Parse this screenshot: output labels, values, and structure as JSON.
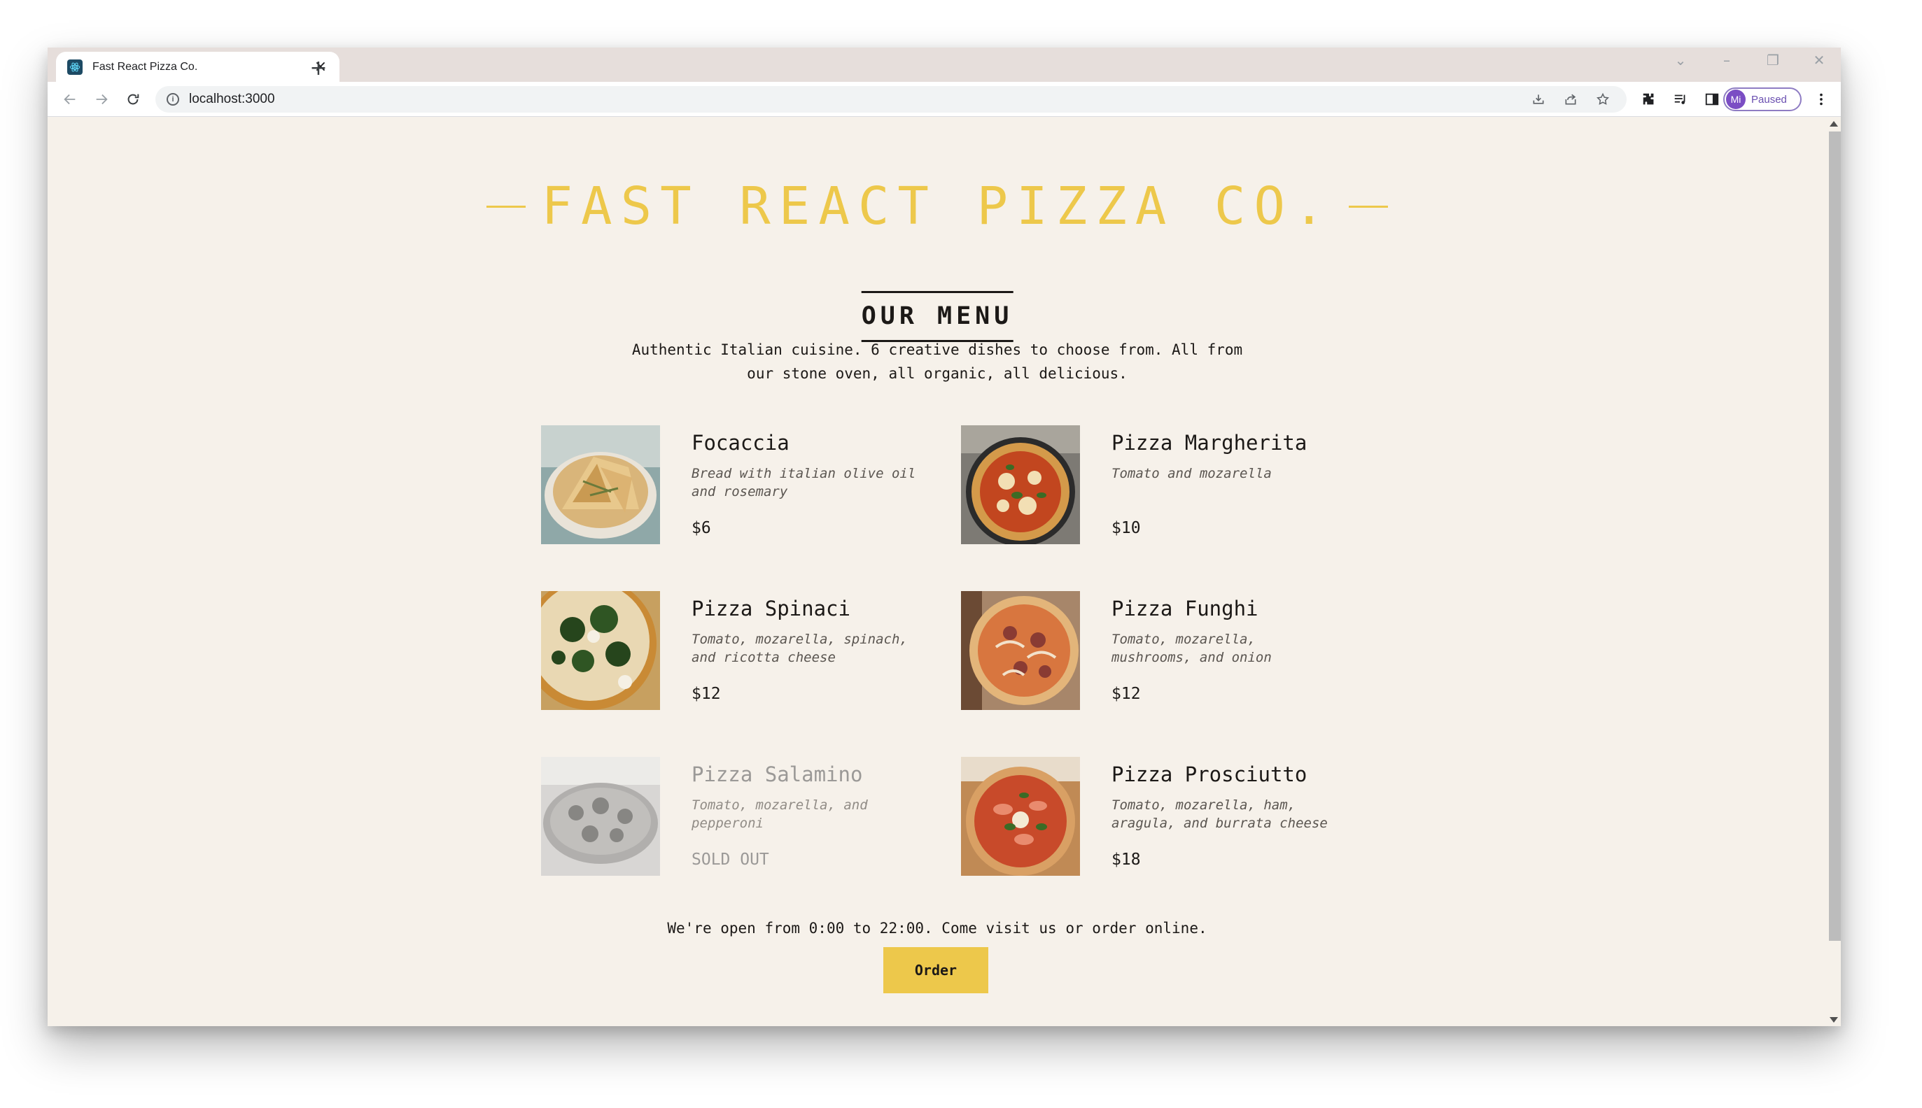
{
  "browser": {
    "tab_title": "Fast React Pizza Co.",
    "url": "localhost:3000",
    "profile_initials": "Mi",
    "profile_status": "Paused"
  },
  "page": {
    "brand": "FAST REACT PIZZA CO.",
    "menu_title": "OUR MENU",
    "intro": "Authentic Italian cuisine. 6 creative dishes to choose from. All from our stone oven, all organic, all delicious.",
    "pizzas": [
      {
        "name": "Focaccia",
        "ingredients": "Bread with italian olive oil and rosemary",
        "price": "$6",
        "sold_out": false
      },
      {
        "name": "Pizza Margherita",
        "ingredients": "Tomato and mozarella",
        "price": "$10",
        "sold_out": false
      },
      {
        "name": "Pizza Spinaci",
        "ingredients": "Tomato, mozarella, spinach, and ricotta cheese",
        "price": "$12",
        "sold_out": false
      },
      {
        "name": "Pizza Funghi",
        "ingredients": "Tomato, mozarella, mushrooms, and onion",
        "price": "$12",
        "sold_out": false
      },
      {
        "name": "Pizza Salamino",
        "ingredients": "Tomato, mozarella, and pepperoni",
        "price": "SOLD OUT",
        "sold_out": true
      },
      {
        "name": "Pizza Prosciutto",
        "ingredients": "Tomato, mozarella, ham, aragula, and burrata cheese",
        "price": "$18",
        "sold_out": false
      }
    ],
    "footer_text": "We're open from 0:00 to 22:00. Come visit us or order online.",
    "order_label": "Order"
  },
  "colors": {
    "accent": "#edc84b",
    "background": "#f6f1ea",
    "text": "#1c1917"
  }
}
